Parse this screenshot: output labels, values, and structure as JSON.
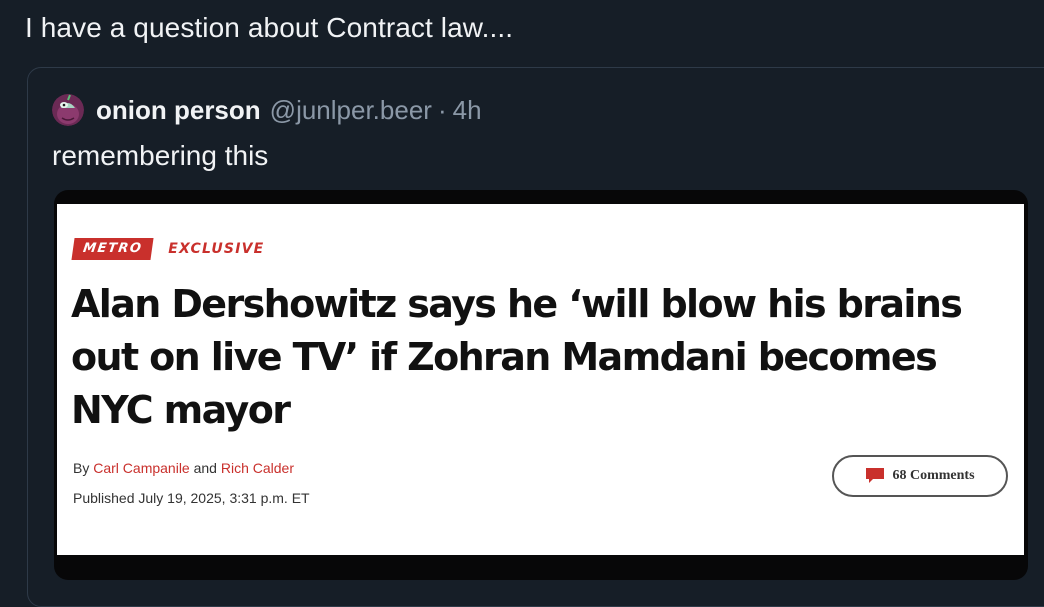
{
  "post": {
    "text": "I have a question about Contract law...."
  },
  "quoted_post": {
    "author_name": "onion person",
    "author_handle": "@junlper.beer",
    "separator": "·",
    "time": "4h",
    "text": "remembering this",
    "avatar_icon": "onion-avatar-icon"
  },
  "article": {
    "section_tag": "METRO",
    "exclusive_tag": "EXCLUSIVE",
    "headline": "Alan Dershowitz says he ‘will blow his brains out on live TV’ if Zohran Mamdani becomes NYC mayor",
    "byline_prefix": "By",
    "author_1": "Carl Campanile",
    "byline_and": "and",
    "author_2": "Rich Calder",
    "published": "Published July 19, 2025, 3:31 p.m. ET",
    "comments_label": "68 Comments",
    "comment_icon": "comment-bubble-icon"
  },
  "colors": {
    "background": "#161e27",
    "card_border": "#2e3a48",
    "muted_text": "#8b98a7",
    "brand_red": "#c9302c"
  }
}
